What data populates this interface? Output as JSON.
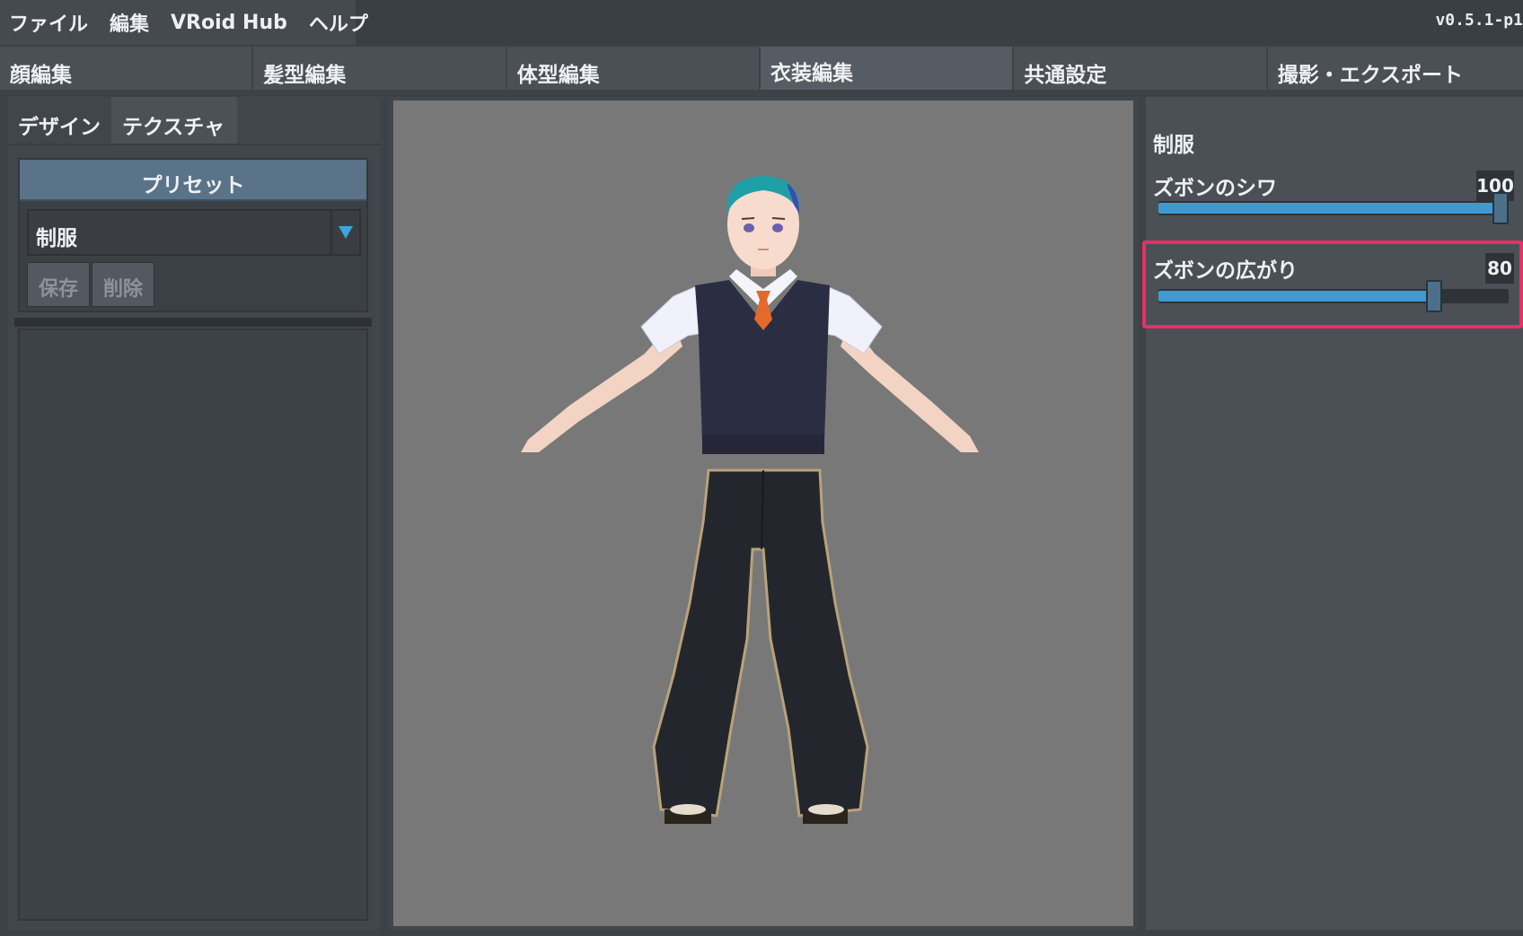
{
  "menu": {
    "items": [
      "ファイル",
      "編集",
      "VRoid Hub",
      "ヘルプ"
    ],
    "version": "v0.5.1-p1"
  },
  "main_tabs": [
    "顔編集",
    "髪型編集",
    "体型編集",
    "衣装編集",
    "共通設定",
    "撮影・エクスポート"
  ],
  "active_main_tab": "衣装編集",
  "left_panel": {
    "sub_tabs": [
      "デザイン",
      "テクスチャ"
    ],
    "active_sub_tab": "デザイン",
    "preset_header": "プリセット",
    "preset_value": "制服",
    "save_label": "保存",
    "delete_label": "削除"
  },
  "right_panel": {
    "category": "制服",
    "params": [
      {
        "label": "ズボンのシワ",
        "value": "100",
        "percent": 100
      },
      {
        "label": "ズボンの広がり",
        "value": "80",
        "percent": 80
      }
    ]
  },
  "colors": {
    "accent": "#3e9ad0",
    "highlight": "#ec2d67",
    "preset_header": "#5a7389"
  },
  "icons": [
    "dropdown-arrow-icon"
  ]
}
